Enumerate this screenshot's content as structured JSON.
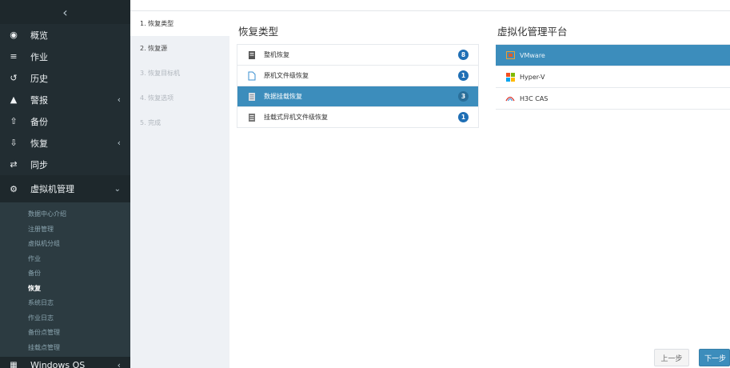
{
  "sidebar": {
    "collapse_glyph": "‹",
    "items": [
      {
        "label": "概览",
        "icon": "dashboard-icon",
        "glyph": "◉"
      },
      {
        "label": "作业",
        "icon": "list-icon",
        "glyph": "≡"
      },
      {
        "label": "历史",
        "icon": "history-icon",
        "glyph": "↺"
      },
      {
        "label": "警报",
        "icon": "warning-icon",
        "glyph": "▲",
        "caret": "‹"
      },
      {
        "label": "备份",
        "icon": "upload-icon",
        "glyph": "⇧"
      },
      {
        "label": "恢复",
        "icon": "download-icon",
        "glyph": "⇩",
        "caret": "‹"
      },
      {
        "label": "同步",
        "icon": "sync-icon",
        "glyph": "⇄"
      }
    ],
    "active_item": {
      "label": "虚拟机管理",
      "icon": "vm-management-icon",
      "glyph": "⚙",
      "caret": "⌄"
    },
    "submenu": [
      "数据中心介绍",
      "注册管理",
      "虚拟机分组",
      "作业",
      "备份",
      "恢复",
      "系统日志",
      "作业日志",
      "备份点管理",
      "挂载点管理"
    ],
    "submenu_active_index": 5,
    "bottom_item": {
      "label": "Windows OS",
      "icon": "windows-icon",
      "glyph": "▦",
      "caret": "‹"
    }
  },
  "wizard": {
    "steps": [
      "1. 恢复类型",
      "2. 恢复源",
      "3. 恢复目标机",
      "4. 恢复选项",
      "5. 完成"
    ],
    "current_index": 0
  },
  "restore_type": {
    "title": "恢复类型",
    "items": [
      {
        "label": "整机恢复",
        "count": "8",
        "icon": "full-machine-icon"
      },
      {
        "label": "原机文件级恢复",
        "count": "1",
        "icon": "file-icon"
      },
      {
        "label": "数据挂载恢复",
        "count": "3",
        "icon": "database-mount-icon",
        "selected": true
      },
      {
        "label": "挂载式异机文件级恢复",
        "count": "1",
        "icon": "mount-file-icon"
      }
    ]
  },
  "platform": {
    "title": "虚拟化管理平台",
    "items": [
      {
        "label": "VMware",
        "icon": "vmware-icon",
        "selected": true
      },
      {
        "label": "Hyper-V",
        "icon": "hyperv-icon"
      },
      {
        "label": "H3C CAS",
        "icon": "h3c-cas-icon"
      }
    ]
  },
  "buttons": {
    "prev": "上一步",
    "next": "下一步"
  },
  "colors": {
    "sidebar_bg": "#222d32",
    "accent": "#3c8dbc",
    "badge": "#1f6fb5",
    "steps_bg": "#eef1f5"
  }
}
